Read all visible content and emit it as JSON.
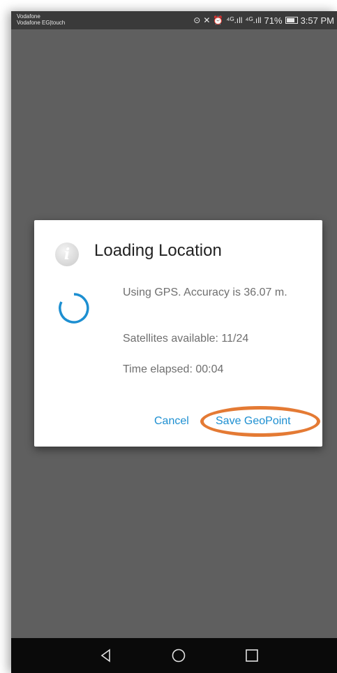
{
  "status_bar": {
    "carrier_line1": "Vodafone",
    "carrier_line2": "Vodafone EG|touch",
    "signal1": "⁴ᴳ.ıll",
    "signal2": "⁴ᴳ.ıll",
    "battery_percent": "71%",
    "time": "3:57 PM"
  },
  "dialog": {
    "title": "Loading Location",
    "icon": "info-icon",
    "accuracy_text": "Using GPS. Accuracy is 36.07 m.",
    "satellites_text": "Satellites available: 11/24",
    "time_elapsed_text": "Time elapsed: 00:04",
    "cancel_label": "Cancel",
    "save_label": "Save GeoPoint"
  },
  "nav_bar": {
    "back_icon": "back-triangle-icon",
    "home_icon": "home-circle-icon",
    "recents_icon": "recents-square-icon"
  },
  "colors": {
    "accent": "#1d8fd1",
    "highlight": "#e47a34",
    "overlay": "#5f5f5f"
  }
}
